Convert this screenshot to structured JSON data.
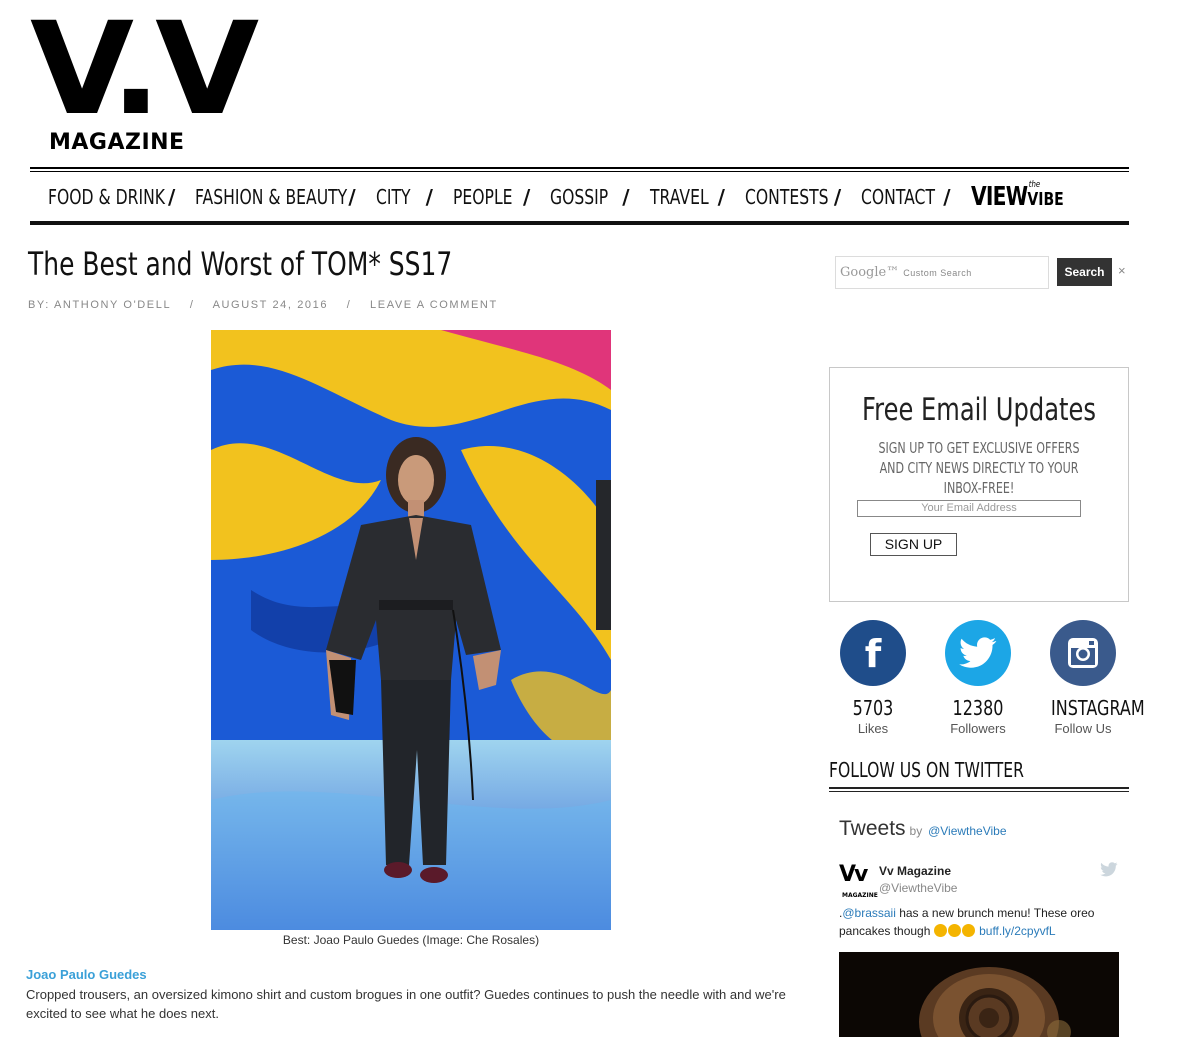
{
  "logo": {
    "mark": "V.V",
    "sub": "MAGAZINE"
  },
  "nav": {
    "items": [
      "FOOD & DRINK",
      "FASHION & BEAUTY",
      "CITY",
      "PEOPLE",
      "GOSSIP",
      "TRAVEL",
      "CONTESTS",
      "CONTACT"
    ],
    "separator": "/",
    "view_logo": {
      "view": "VIEW",
      "the": "the",
      "vibe": "VIBE"
    }
  },
  "article": {
    "title": "The Best and Worst of TOM* SS17",
    "byline": {
      "author": "BY: ANTHONY O'DELL",
      "sep": "/",
      "date": "AUGUST 24, 2016",
      "comment": "LEAVE A COMMENT"
    },
    "caption": "Best: Joao Paulo Guedes (Image: Che Rosales)",
    "lead_name": "Joao Paulo Guedes",
    "lead_text": "Cropped trousers, an oversized kimono shirt and custom brogues in one outfit? Guedes continues to push the needle with and we're excited to see what he does next."
  },
  "search": {
    "brand": "Google™",
    "placeholder": "Custom Search",
    "button": "Search",
    "clear": "×"
  },
  "email": {
    "title": "Free Email Updates",
    "subtitle": "SIGN UP TO GET EXCLUSIVE OFFERS AND CITY NEWS DIRECTLY TO YOUR INBOX-FREE!",
    "placeholder": "Your Email Address",
    "button": "SIGN UP"
  },
  "social": [
    {
      "count": "5703",
      "label": "Likes",
      "color": "#1f4d8a",
      "icon": "facebook-icon"
    },
    {
      "count": "12380",
      "label": "Followers",
      "color": "#1ca6e6",
      "icon": "twitter-icon"
    },
    {
      "count": "INSTAGRAM",
      "label": "Follow Us",
      "color": "#3a5a8c",
      "icon": "instagram-icon"
    }
  ],
  "follow_twitter": "FOLLOW US ON TWITTER",
  "tweets": {
    "title": "Tweets",
    "by": "by",
    "handle": "@ViewtheVibe",
    "name": "Vv Magazine",
    "user": "@ViewtheVibe",
    "text_prefix": ".",
    "mention": "@brassaii",
    "text": " has a new brunch menu! These oreo pancakes though ",
    "link": "buff.ly/2cpyvfL"
  },
  "colors": {
    "link_blue": "#3aa0d8",
    "twitter_link": "#2b7bb9"
  }
}
